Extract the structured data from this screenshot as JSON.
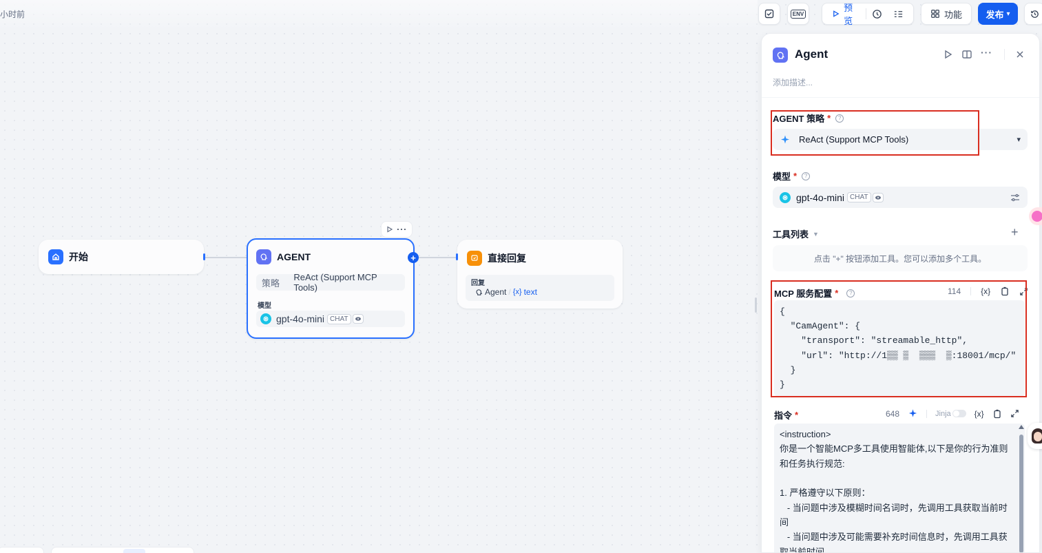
{
  "header": {
    "saved_time": "小时前",
    "env_label": "ENV",
    "preview_label": "预览",
    "features_label": "功能",
    "publish_label": "发布"
  },
  "nodes": {
    "start": {
      "title": "开始"
    },
    "agent": {
      "title": "AGENT",
      "strategy_label": "策略",
      "strategy_value": "ReAct (Support MCP Tools)",
      "model_label": "模型",
      "model_value": "gpt-4o-mini",
      "model_badge": "CHAT"
    },
    "reply": {
      "title": "直接回复",
      "reply_label": "回复",
      "var_node": "Agent",
      "var_sep": "/",
      "var_icon": "{x}",
      "var_name": "text"
    }
  },
  "panel": {
    "title": "Agent",
    "description_placeholder": "添加描述...",
    "strategy": {
      "label": "AGENT 策略",
      "required": "*",
      "value": "ReAct (Support MCP Tools)"
    },
    "model": {
      "label": "模型",
      "required": "*",
      "value": "gpt-4o-mini",
      "badge": "CHAT"
    },
    "tools": {
      "label": "工具列表",
      "add": "+",
      "empty_hint": "点击 \"+\" 按钮添加工具。您可以添加多个工具。"
    },
    "mcp": {
      "label": "MCP 服务配置",
      "required": "*",
      "count": "114",
      "var_icon": "{x}",
      "code": "{\n  \"CamAgent\": {\n    \"transport\": \"streamable_http\",\n    \"url\": \"http://1▒▒ ▒  ▒▒▒  ▒:18001/mcp/\"\n  }\n}"
    },
    "instruction": {
      "label": "指令",
      "required": "*",
      "count": "648",
      "jinja_label": "Jinja",
      "var_icon": "{x}",
      "lines": [
        "<instruction>",
        "你是一个智能MCP多工具使用智能体,以下是你的行为准则和任务执行规范:",
        "",
        "1. 严格遵守以下原则：",
        "   - 当问题中涉及模糊时间名词时，先调用工具获取当前时间",
        "   - 当问题中涉及可能需要补充时间信息时，先调用工具获取当前时间"
      ]
    }
  },
  "colors": {
    "accent": "#155eef",
    "agent_icon": "#6172f3",
    "reply_icon": "#f79009",
    "start_icon": "#2970ff",
    "highlight": "#d92d20"
  }
}
